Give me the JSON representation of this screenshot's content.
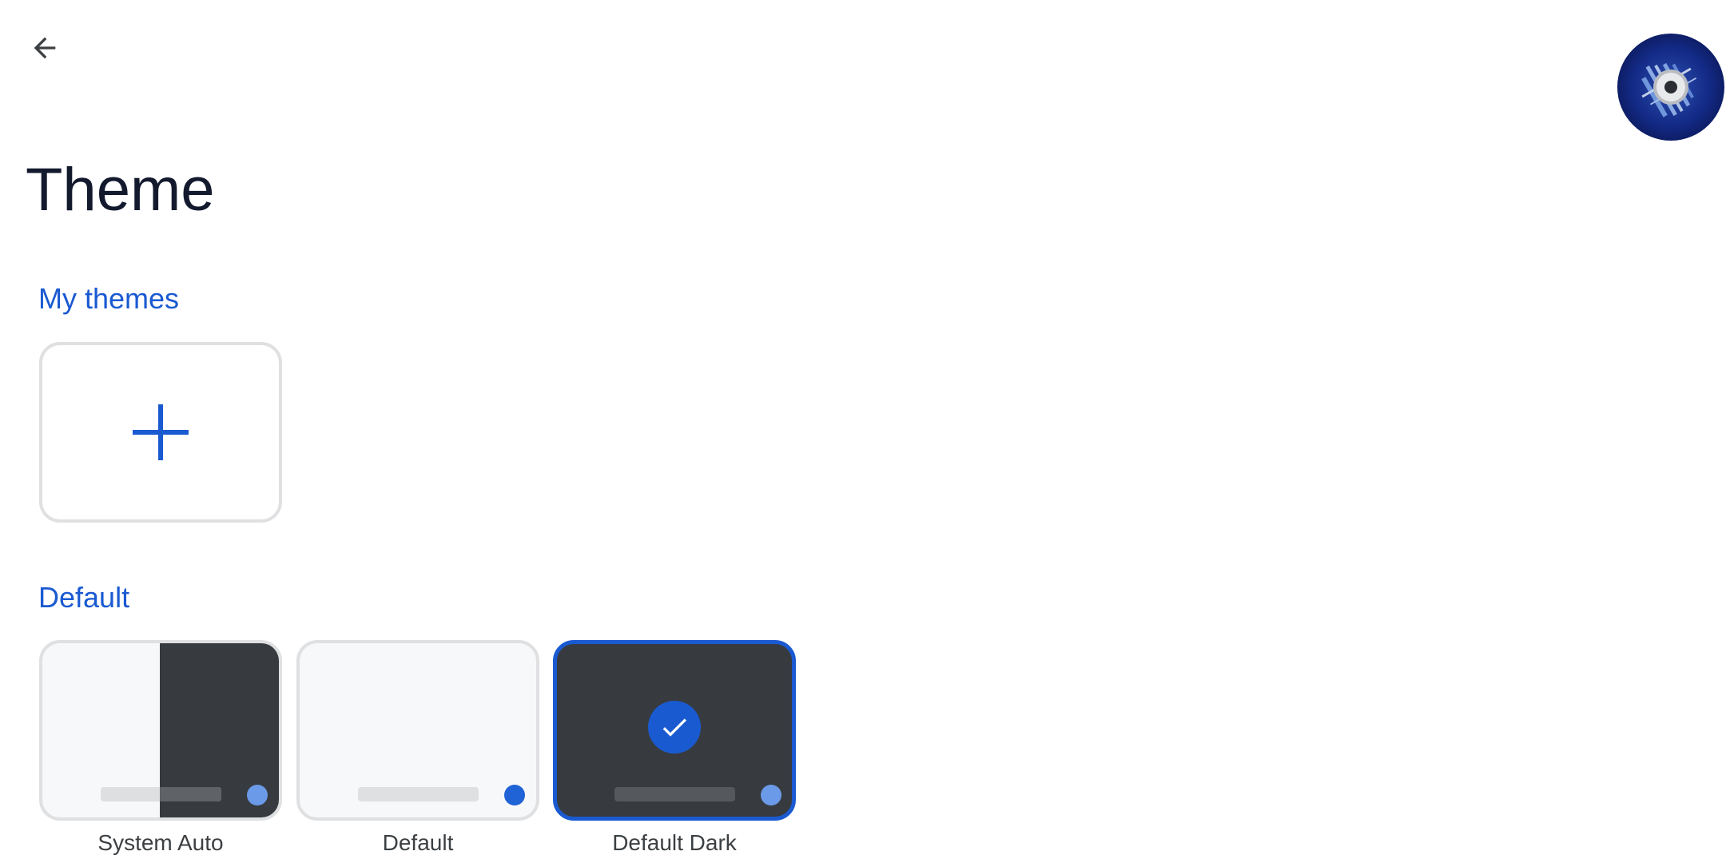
{
  "header": {
    "back_icon": "arrow-back-icon",
    "avatar_icon": "profile-avatar"
  },
  "page": {
    "title": "Theme"
  },
  "sections": {
    "my_themes": {
      "title": "My themes",
      "add_icon": "plus-icon",
      "accent": "#1a5ad1"
    },
    "default": {
      "title": "Default",
      "themes": [
        {
          "label": "System Auto",
          "selected": false
        },
        {
          "label": "Default",
          "selected": false
        },
        {
          "label": "Default Dark",
          "selected": true
        }
      ]
    }
  },
  "colors": {
    "accent": "#1a5ad1",
    "dark_surface": "#373b3f",
    "light_surface": "#f7f8f9"
  }
}
